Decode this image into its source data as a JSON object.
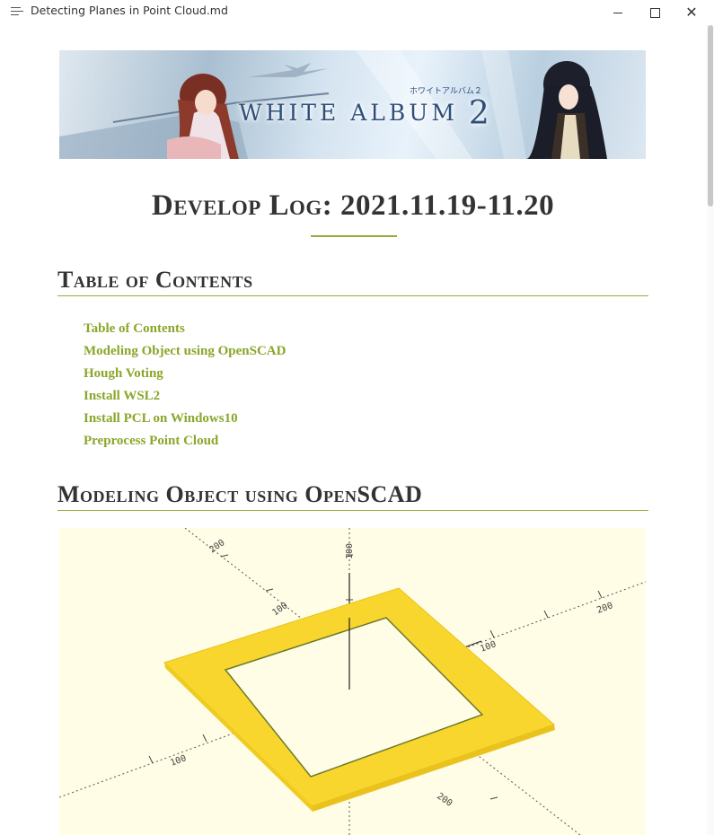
{
  "window": {
    "title": "Detecting Planes in Point Cloud.md",
    "minimize_icon": "minimize-icon",
    "maximize_icon": "maximize-icon",
    "close_icon": "close-icon",
    "close_glyph": "✕"
  },
  "banner": {
    "logo_text": "WHITE ALBUM",
    "logo_number": "2",
    "logo_kana": "ホワイトアルバム２"
  },
  "page": {
    "title": "Develop Log: 2021.11.19-11.20"
  },
  "sections": {
    "toc_heading": "Table of Contents",
    "modeling_heading": "Modeling Object using OpenSCAD"
  },
  "toc": {
    "items": [
      "Table of Contents",
      "Modeling Object using OpenSCAD",
      "Hough Voting",
      "Install WSL2",
      "Install PCL on Windows10",
      "Preprocess Point Cloud"
    ]
  },
  "render": {
    "axis_labels": [
      "100",
      "200",
      "100",
      "200",
      "100",
      "100",
      "200"
    ]
  },
  "colors": {
    "accent": "#8aa62a",
    "rule": "#9aab3a",
    "render_bg": "#fffde5",
    "frame": "#f9d62e"
  }
}
